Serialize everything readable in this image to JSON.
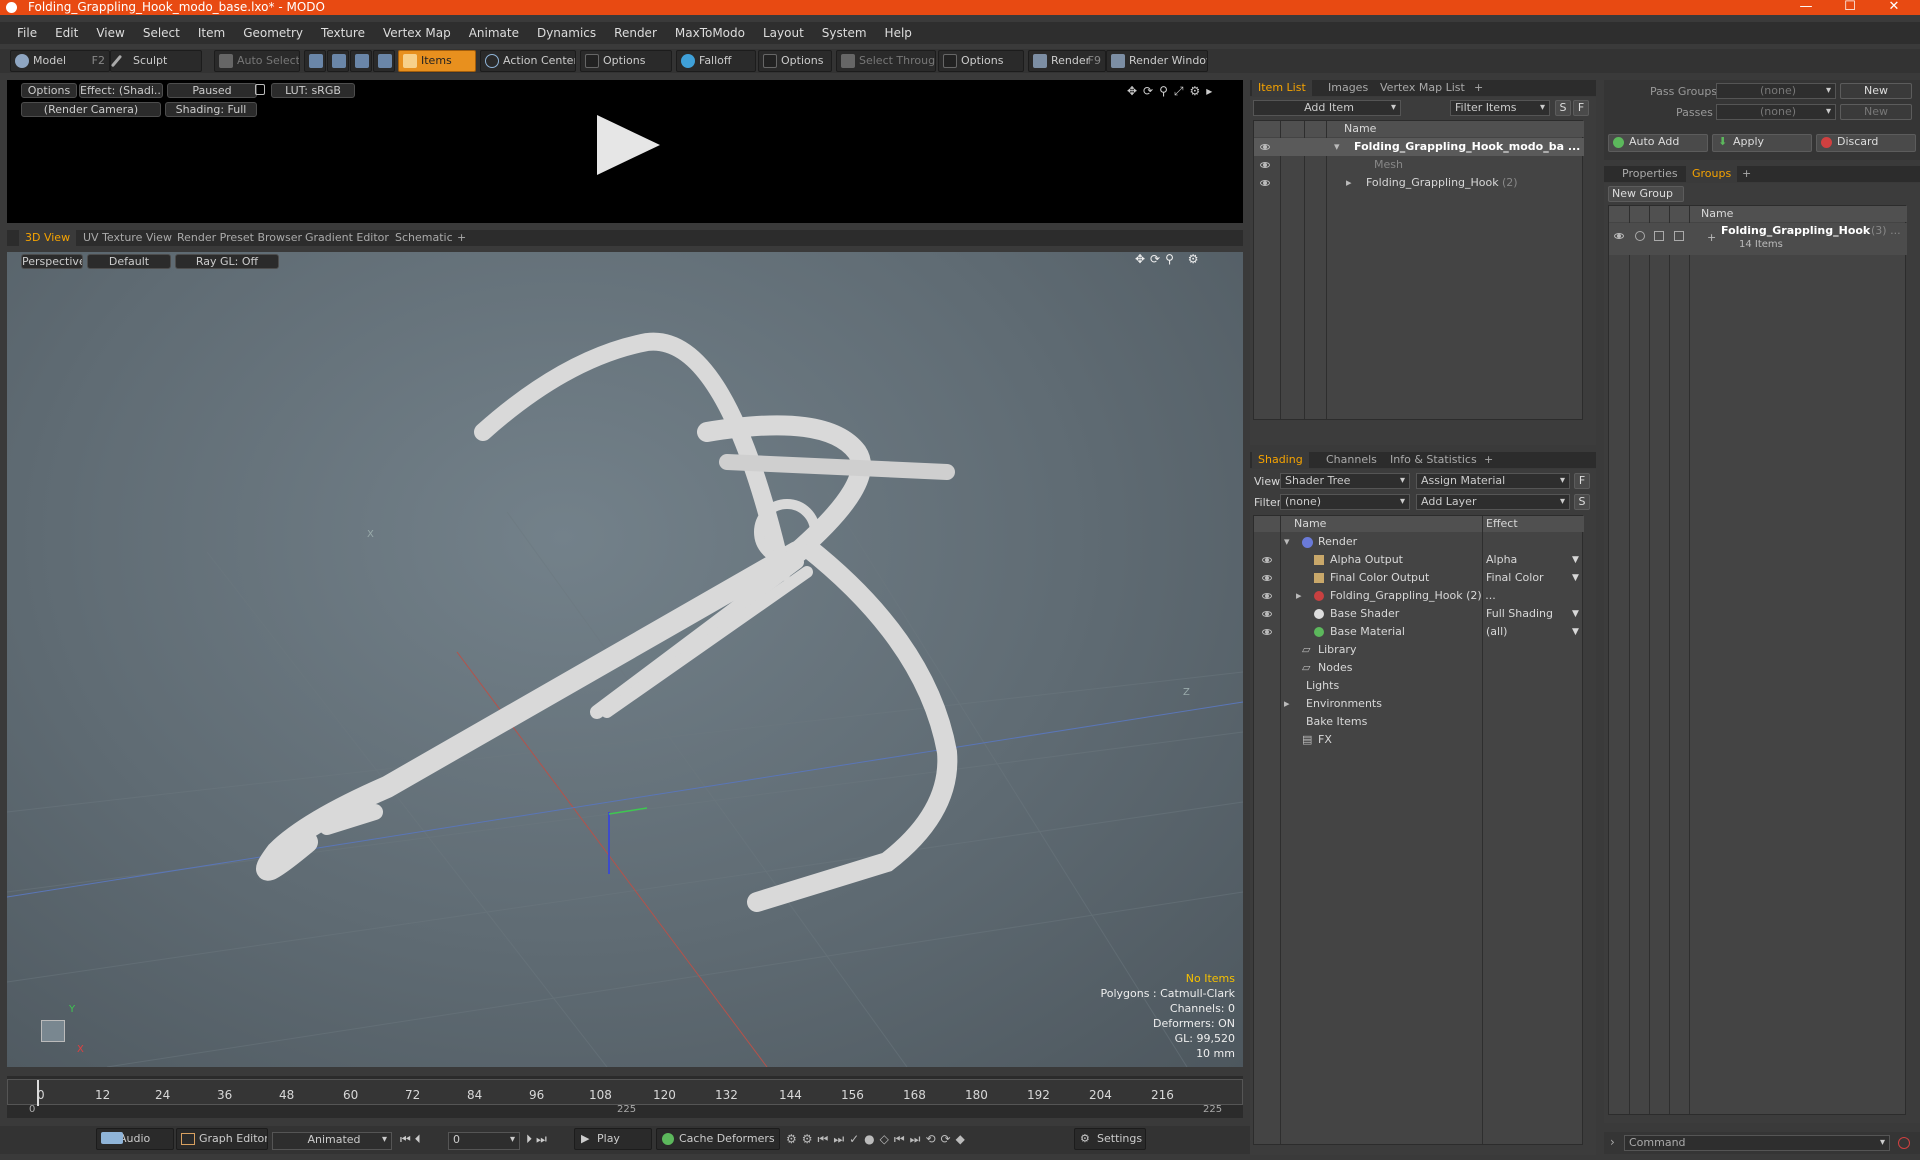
{
  "window": {
    "title": "Folding_Grappling_Hook_modo_base.lxo* - MODO",
    "minimize": "—",
    "maximize": "☐",
    "close": "✕"
  },
  "menu": [
    "File",
    "Edit",
    "View",
    "Select",
    "Item",
    "Geometry",
    "Texture",
    "Vertex Map",
    "Animate",
    "Dynamics",
    "Render",
    "MaxToModo",
    "Layout",
    "System",
    "Help"
  ],
  "toolbar": {
    "model": "Model",
    "model_key": "F2",
    "sculpt": "Sculpt",
    "auto_select": "Auto Select",
    "items": "Items",
    "action_center": "Action Center",
    "options1": "Options",
    "falloff": "Falloff",
    "options2": "Options",
    "select_through": "Select Through",
    "options3": "Options",
    "render": "Render",
    "render_key": "F9",
    "render_window": "Render Window"
  },
  "preview": {
    "options": "Options",
    "effect": "Effect: (Shadi...",
    "paused": "Paused",
    "lut": "LUT: sRGB",
    "camera": "(Render Camera)",
    "shading": "Shading: Full"
  },
  "viewport_tabs": [
    "3D View",
    "UV Texture View",
    "Render Preset Browser",
    "Gradient Editor",
    "Schematic",
    "+"
  ],
  "viewport": {
    "perspective": "Perspective",
    "default": "Default",
    "raygl": "Ray GL: Off",
    "no_items": "No Items",
    "polygons": "Polygons : Catmull-Clark",
    "channels": "Channels: 0",
    "deformers": "Deformers: ON",
    "gl": "GL: 99,520",
    "scale": "10 mm",
    "axis_y": "Y",
    "axis_x": "X",
    "axis_z": "Z"
  },
  "timeline": {
    "ticks": [
      "0",
      "12",
      "24",
      "36",
      "48",
      "60",
      "72",
      "84",
      "96",
      "108",
      "120",
      "132",
      "144",
      "156",
      "168",
      "180",
      "192",
      "204",
      "216"
    ],
    "start": "0",
    "mid": "225",
    "end": "225"
  },
  "transport": {
    "audio": "Audio",
    "graph_editor": "Graph Editor",
    "animated": "Animated",
    "frame": "0",
    "play": "Play",
    "cache": "Cache Deformers",
    "settings": "Settings"
  },
  "item_list": {
    "tabs": [
      "Item List",
      "Images",
      "Vertex Map List",
      "+"
    ],
    "add_item": "Add Item",
    "filter": "Filter Items",
    "s": "S",
    "f": "F",
    "name_col": "Name",
    "rows": [
      {
        "label": "Folding_Grappling_Hook_modo_ba ...",
        "count": ""
      },
      {
        "label": "Mesh",
        "count": ""
      },
      {
        "label": "Folding_Grappling_Hook",
        "count": "(2)"
      }
    ]
  },
  "shading": {
    "tabs": [
      "Shading",
      "Channels",
      "Info & Statistics",
      "+"
    ],
    "view_label": "View",
    "view_value": "Shader Tree",
    "assign": "Assign Material",
    "f": "F",
    "filter_label": "Filter",
    "filter_value": "(none)",
    "add_layer": "Add Layer",
    "s": "S",
    "name_col": "Name",
    "effect_col": "Effect",
    "rows": [
      {
        "label": "Render",
        "effect": ""
      },
      {
        "label": "Alpha Output",
        "effect": "Alpha"
      },
      {
        "label": "Final Color Output",
        "effect": "Final Color"
      },
      {
        "label": "Folding_Grappling_Hook (2) ...",
        "effect": ""
      },
      {
        "label": "Base Shader",
        "effect": "Full Shading"
      },
      {
        "label": "Base Material",
        "effect": "(all)"
      },
      {
        "label": "Library",
        "effect": ""
      },
      {
        "label": "Nodes",
        "effect": ""
      },
      {
        "label": "Lights",
        "effect": ""
      },
      {
        "label": "Environments",
        "effect": ""
      },
      {
        "label": "Bake Items",
        "effect": ""
      },
      {
        "label": "FX",
        "effect": ""
      }
    ]
  },
  "right": {
    "pass_groups": "Pass Groups",
    "pass_groups_val": "(none)",
    "new1": "New",
    "passes": "Passes",
    "passes_val": "(none)",
    "new2": "New",
    "auto_add": "Auto Add",
    "apply": "Apply",
    "discard": "Discard",
    "tabs": [
      "Properties",
      "Groups",
      "+"
    ],
    "new_group": "New Group",
    "name_col": "Name",
    "group_name": "Folding_Grappling_Hook",
    "group_count": "(3) ...",
    "group_items": "14 Items",
    "command": "Command"
  },
  "colors": {
    "accent": "#f6a300",
    "titlebar": "#e84a12",
    "items_btn": "#e8901e"
  }
}
